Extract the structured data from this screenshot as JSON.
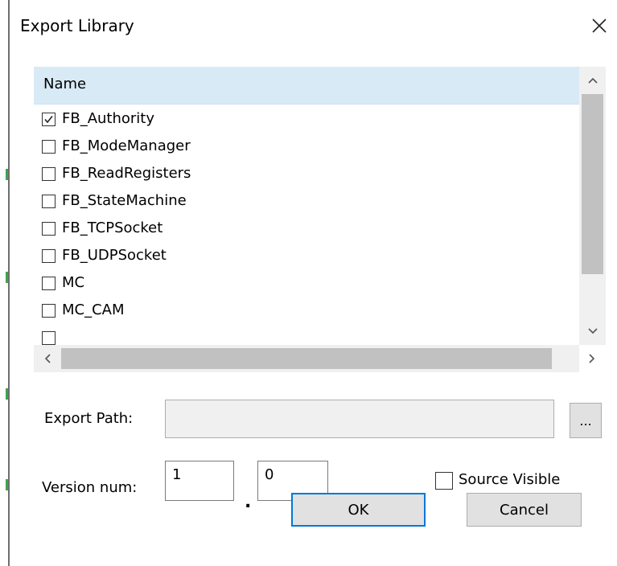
{
  "dialog": {
    "title": "Export Library",
    "close_icon": "close-icon"
  },
  "list": {
    "header": "Name",
    "items": [
      {
        "label": "FB_Authority",
        "checked": true
      },
      {
        "label": "FB_ModeManager",
        "checked": false
      },
      {
        "label": "FB_ReadRegisters",
        "checked": false
      },
      {
        "label": "FB_StateMachine",
        "checked": false
      },
      {
        "label": "FB_TCPSocket",
        "checked": false
      },
      {
        "label": "FB_UDPSocket",
        "checked": false
      },
      {
        "label": "MC",
        "checked": false
      },
      {
        "label": "MC_CAM",
        "checked": false
      }
    ]
  },
  "export_path": {
    "label": "Export Path:",
    "value": "",
    "browse_label": "..."
  },
  "version": {
    "label": "Version num:",
    "major": "1",
    "separator": ".",
    "minor": "0"
  },
  "source_visible": {
    "label": "Source Visible",
    "checked": false
  },
  "buttons": {
    "ok": "OK",
    "cancel": "Cancel"
  },
  "colors": {
    "header_bg": "#d9eaf7",
    "ok_border": "#0078d7",
    "scroll_thumb": "#c1c1c1"
  }
}
